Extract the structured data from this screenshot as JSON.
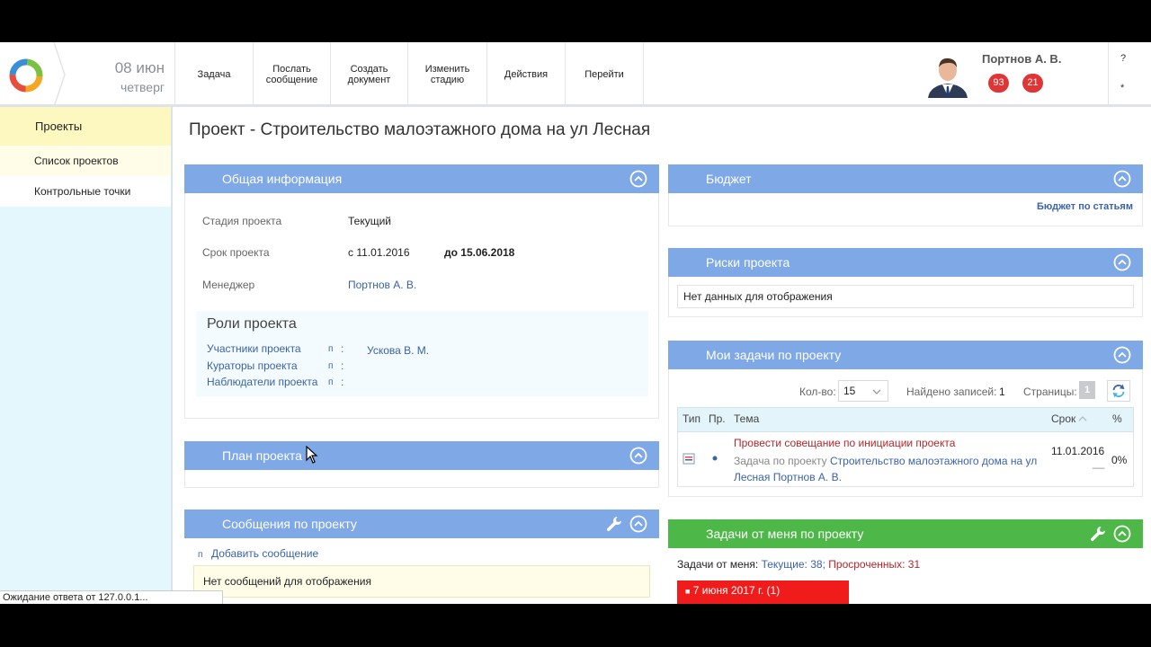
{
  "header": {
    "date_day": "08 июн",
    "date_weekday": "четверг",
    "toolbar": [
      {
        "label": "Задача"
      },
      {
        "label": "Послать сообщение"
      },
      {
        "label": "Создать документ"
      },
      {
        "label": "Изменить стадию"
      },
      {
        "label": "Действия"
      },
      {
        "label": "Перейти"
      }
    ],
    "user_name": "Портнов А. В.",
    "badge_1": "93",
    "badge_2": "21",
    "help": "?",
    "star": "*"
  },
  "sidebar": {
    "section": "Проекты",
    "items": [
      {
        "label": "Список проектов"
      },
      {
        "label": "Контрольные точки"
      }
    ]
  },
  "page_title": "Проект - Строительство малоэтажного дома на ул Лесная",
  "general": {
    "title": "Общая информация",
    "stage_label": "Стадия проекта",
    "stage_value": "Текущий",
    "term_label": "Срок проекта",
    "term_from": "с 11.01.2016",
    "term_to": "до 15.06.2018",
    "manager_label": "Менеджер",
    "manager_value": "Портнов А. В.",
    "roles_title": "Роли проекта",
    "roles": [
      {
        "label": "Участники проекта",
        "marker": "п",
        "sep": ":",
        "value": "Ускова В. М."
      },
      {
        "label": "Кураторы проекта",
        "marker": "п",
        "sep": ":",
        "value": ""
      },
      {
        "label": "Наблюдатели проекта",
        "marker": "п",
        "sep": ":",
        "value": ""
      }
    ]
  },
  "plan": {
    "title": "План проекта"
  },
  "messages": {
    "title": "Сообщения по проекту",
    "add_marker": "п",
    "add_label": "Добавить сообщение",
    "empty": "Нет сообщений для отображения"
  },
  "budget": {
    "title": "Бюджет",
    "link": "Бюджет по статьям"
  },
  "risks": {
    "title": "Риски проекта",
    "empty": "Нет данных для отображения"
  },
  "my_tasks": {
    "title": "Мои задачи по проекту",
    "count_label": "Кол-во:",
    "count_value": "15",
    "found_label": "Найдено записей:",
    "found_value": "1",
    "pages_label": "Страницы:",
    "page_value": "1",
    "columns": {
      "type": "Тип",
      "priority": "Пр.",
      "subject": "Тема",
      "due": "Срок",
      "percent": "%"
    },
    "row": {
      "title": "Провести совещание по инициации проекта",
      "sub_prefix": "Задача по проекту",
      "sub_project": "Строительство малоэтажного дома на ул Лесная",
      "sub_user": "Портнов А. В.",
      "due": "11.01.2016",
      "due_extra": "__",
      "percent": "0%"
    }
  },
  "from_me": {
    "title": "Задачи от меня по проекту",
    "summary_label": "Задачи от меня:",
    "current_label": "Текущие: 38;",
    "overdue_label": "Просроченных: 31",
    "group_marker": "■",
    "group_label": "7 июня 2017 г. (1)"
  },
  "status_bar": "Ожидание ответа от 127.0.0.1..."
}
